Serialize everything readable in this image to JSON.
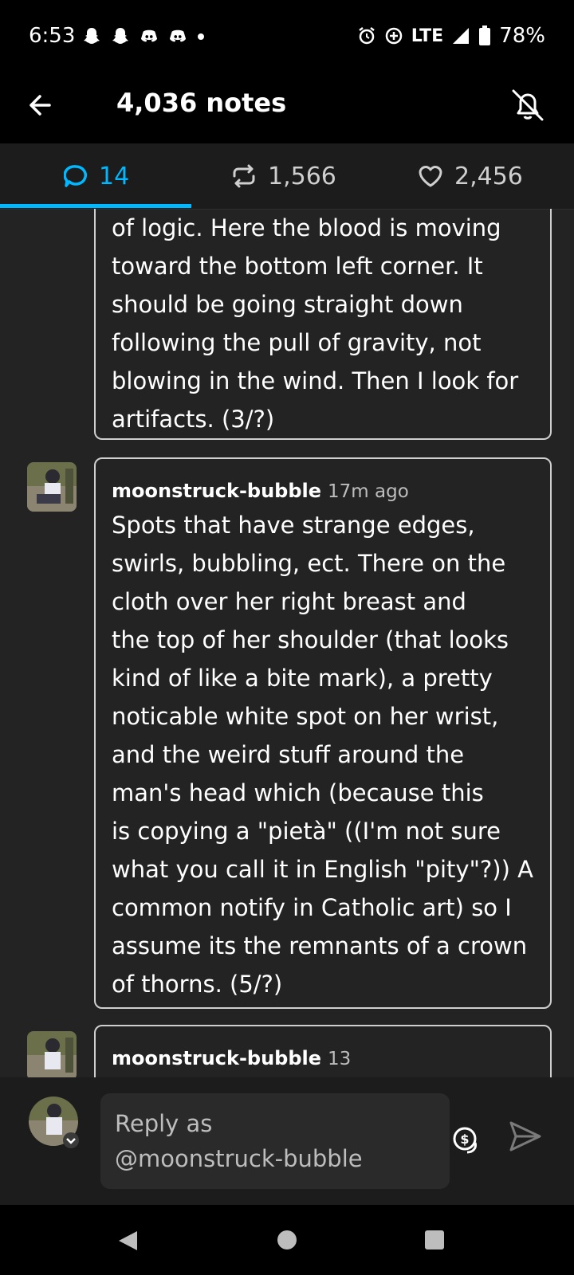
{
  "status_bar": {
    "time": "6:53",
    "notification_icons": [
      "snapchat-icon",
      "snapchat-icon",
      "discord-icon",
      "discord-icon",
      "dot-icon"
    ],
    "network": "LTE",
    "battery": "78%"
  },
  "header": {
    "title": "4,036 notes",
    "icons": [
      "back-arrow-icon",
      "mute-bell-icon"
    ]
  },
  "tabs": [
    {
      "label": "14",
      "icon": "comment-icon",
      "active": true
    },
    {
      "label": "1,566",
      "icon": "reblog-icon",
      "active": false
    },
    {
      "label": "2,456",
      "icon": "heart-icon",
      "active": false
    }
  ],
  "notes": [
    {
      "lines": [
        "of logic. Here the blood is moving",
        "toward the bottom left corner. It",
        "should be going straight down",
        "following the pull of gravity, not",
        "blowing in the wind. Then I look for",
        "artifacts. (3/?)"
      ]
    },
    {
      "username": "moonstruck-bubble",
      "time_ago": "17m ago",
      "lines": [
        "Spots that have strange edges,",
        "swirls, bubbling, ect. There on the",
        "cloth over her right breast and",
        "the top of her shoulder (that looks",
        "kind of like a bite mark), a pretty",
        "noticable white spot on her wrist,",
        "and the weird stuff around the",
        "man's head which (because this",
        "is copying a \"pietà\" ((I'm not sure",
        "what you call it in English \"pity\"?)) A",
        "common notify in Catholic art) so I",
        "assume its the remnants of a crown",
        "of thorns. (5/?)"
      ]
    },
    {
      "username": "moonstruck-bubble",
      "time_ago": "13"
    }
  ],
  "reply": {
    "placeholder_line1": "Reply as",
    "placeholder_line2": "@moonstruck-bubble"
  },
  "colors": {
    "accent": "#00b8ff",
    "background": "#232323",
    "card_border": "#cfcfcf"
  }
}
